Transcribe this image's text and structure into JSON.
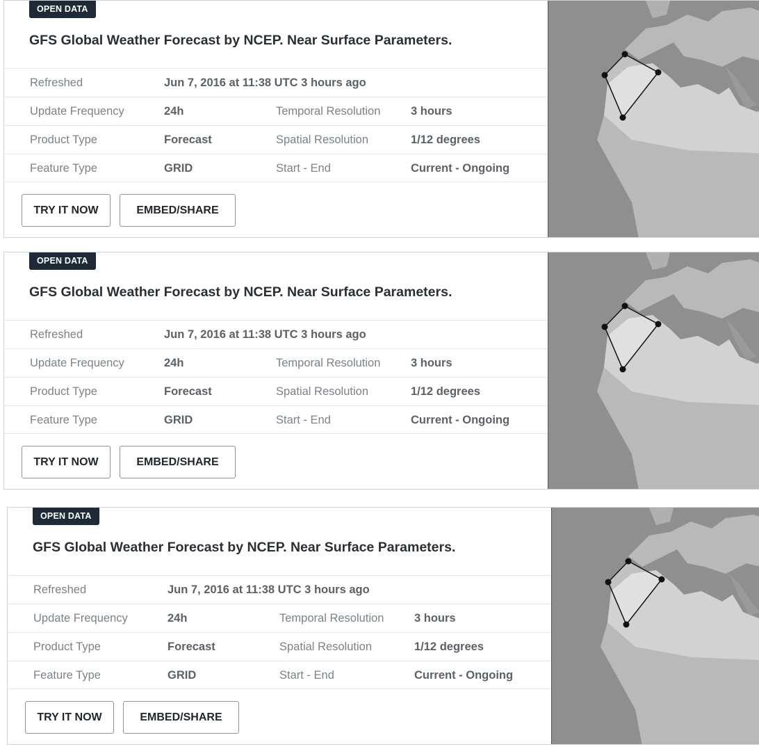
{
  "cards": [
    {
      "badge": "OPEN DATA",
      "title": "GFS Global Weather Forecast by NCEP. Near Surface Parameters.",
      "refreshed_label": "Refreshed",
      "refreshed_value": "Jun 7, 2016 at 11:38 UTC 3 hours ago",
      "update_frequency_label": "Update Frequency",
      "update_frequency_value": "24h",
      "temporal_resolution_label": "Temporal Resolution",
      "temporal_resolution_value": "3 hours",
      "product_type_label": "Product Type",
      "product_type_value": "Forecast",
      "spatial_resolution_label": "Spatial Resolution",
      "spatial_resolution_value": "1/12 degrees",
      "feature_type_label": "Feature Type",
      "feature_type_value": "GRID",
      "start_end_label": "Start - End",
      "start_end_value": "Current - Ongoing",
      "try_button": "TRY IT NOW",
      "embed_button": "EMBED/SHARE"
    },
    {
      "badge": "OPEN DATA",
      "title": "GFS Global Weather Forecast by NCEP. Near Surface Parameters.",
      "refreshed_label": "Refreshed",
      "refreshed_value": "Jun 7, 2016 at 11:38 UTC 3 hours ago",
      "update_frequency_label": "Update Frequency",
      "update_frequency_value": "24h",
      "temporal_resolution_label": "Temporal Resolution",
      "temporal_resolution_value": "3 hours",
      "product_type_label": "Product Type",
      "product_type_value": "Forecast",
      "spatial_resolution_label": "Spatial Resolution",
      "spatial_resolution_value": "1/12 degrees",
      "feature_type_label": "Feature Type",
      "feature_type_value": "GRID",
      "start_end_label": "Start - End",
      "start_end_value": "Current - Ongoing",
      "try_button": "TRY IT NOW",
      "embed_button": "EMBED/SHARE"
    },
    {
      "badge": "OPEN DATA",
      "title": "GFS Global Weather Forecast by NCEP. Near Surface Parameters.",
      "refreshed_label": "Refreshed",
      "refreshed_value": "Jun 7, 2016 at 11:38 UTC 3 hours ago",
      "update_frequency_label": "Update Frequency",
      "update_frequency_value": "24h",
      "temporal_resolution_label": "Temporal Resolution",
      "temporal_resolution_value": "3 hours",
      "product_type_label": "Product Type",
      "product_type_value": "Forecast",
      "spatial_resolution_label": "Spatial Resolution",
      "spatial_resolution_value": "1/12 degrees",
      "feature_type_label": "Feature Type",
      "feature_type_value": "GRID",
      "start_end_label": "Start - End",
      "start_end_value": "Current - Ongoing",
      "try_button": "TRY IT NOW",
      "embed_button": "EMBED/SHARE"
    }
  ],
  "colors": {
    "badge_bg": "#1e2a36",
    "label_text": "#7b8289",
    "value_text": "#5b6167",
    "map_sea": "#8f8f8f",
    "map_land": "#b9b9b9",
    "map_desert": "#d2d2d2"
  },
  "icons": {
    "map": "region-map-thumbnail",
    "polygon": "area-polygon-icon"
  }
}
